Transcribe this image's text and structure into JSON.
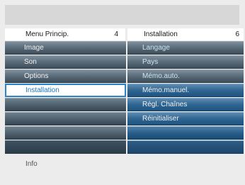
{
  "left_menu": {
    "title": "Menu Princip.",
    "number": "4",
    "items": [
      {
        "label": "Image"
      },
      {
        "label": "Son"
      },
      {
        "label": "Options"
      },
      {
        "label": "Installation",
        "selected": true
      }
    ]
  },
  "right_menu": {
    "title": "Installation",
    "number": "6",
    "items": [
      {
        "label": "Langage"
      },
      {
        "label": "Pays"
      },
      {
        "label": "Mémo.auto."
      },
      {
        "label": "Mémo.manuel."
      },
      {
        "label": "Régl. Chaînes"
      },
      {
        "label": "Réinitialiser"
      }
    ]
  },
  "footer": {
    "info_label": "Info"
  },
  "colors": {
    "background": "#ececec",
    "selected_border": "#2e84c8",
    "selected_text": "#1f76bf",
    "menu_gray": "#596a78",
    "menu_blue": "#2f6591"
  }
}
